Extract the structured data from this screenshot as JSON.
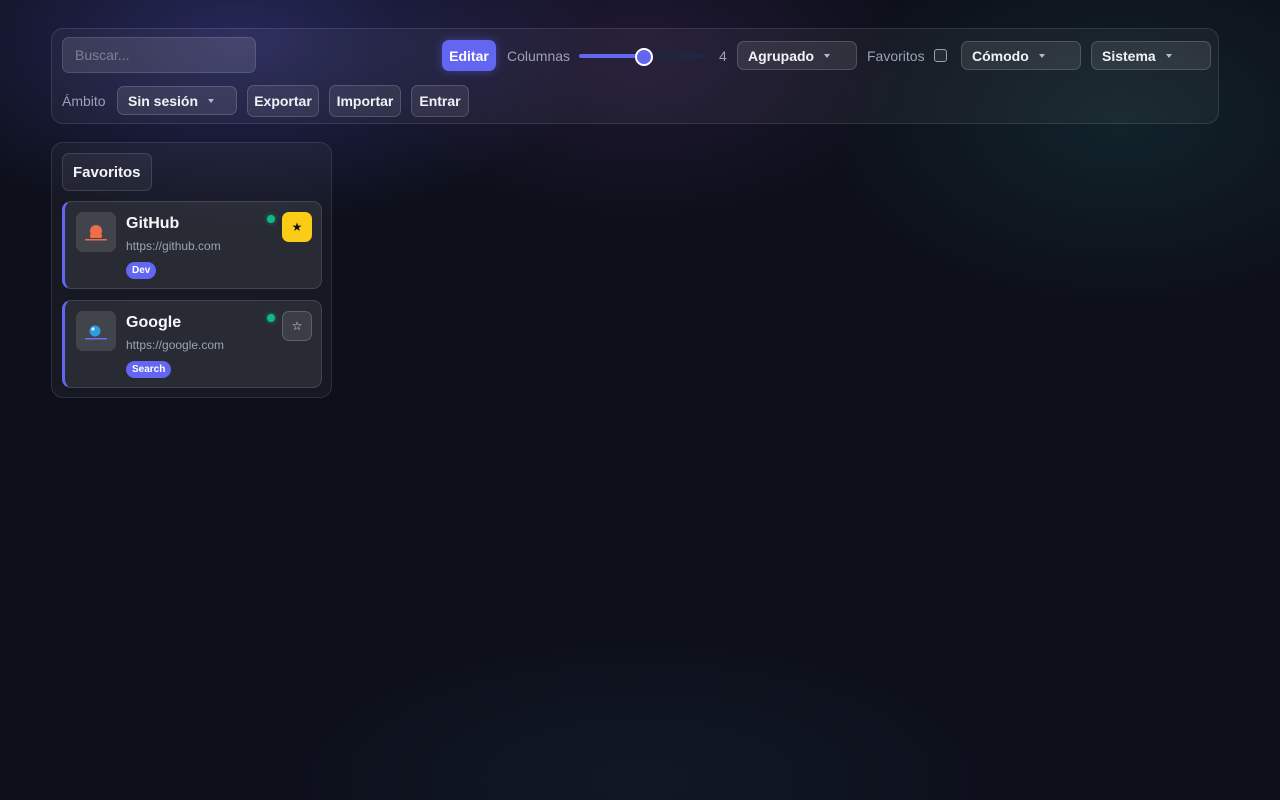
{
  "toolbar": {
    "search_placeholder": "Buscar...",
    "edit_label": "Editar",
    "columns_label": "Columnas",
    "columns_value": "4",
    "columns_slider": {
      "min": 1,
      "max": 6,
      "value": 4
    },
    "grouping_select": "Agrupado",
    "favorites_label": "Favoritos",
    "favorites_checked": false,
    "density_select": "Cómodo",
    "theme_select": "Sistema",
    "scope_label": "Ámbito",
    "scope_select": "Sin sesión",
    "export_label": "Exportar",
    "import_label": "Importar",
    "login_label": "Entrar"
  },
  "panel": {
    "title": "Favoritos",
    "cards": [
      {
        "title": "GitHub",
        "url": "https://github.com",
        "tag": "Dev",
        "status": "online",
        "favorite": true,
        "star": "★",
        "icon": "github-favicon-icon"
      },
      {
        "title": "Google",
        "url": "https://google.com",
        "tag": "Search",
        "status": "online",
        "favorite": false,
        "star": "☆",
        "icon": "google-favicon-icon"
      }
    ]
  },
  "colors": {
    "accent": "#6366f1",
    "favorite": "#facc15",
    "status_online": "#10b981",
    "background": "#0d101b"
  }
}
